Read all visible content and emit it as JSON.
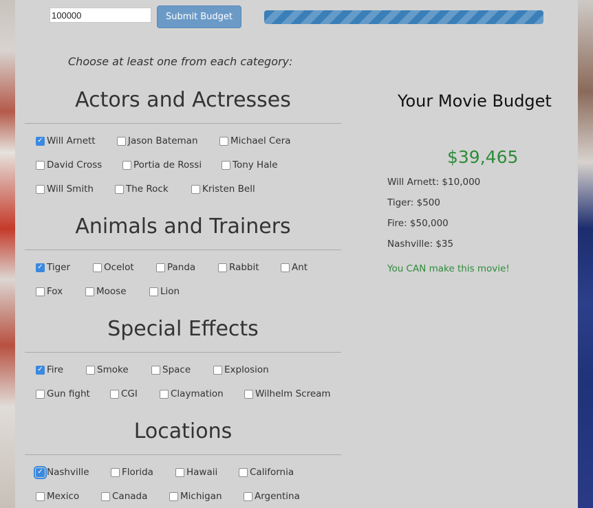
{
  "budget_form": {
    "input_value": "100000",
    "submit_label": "Submit Budget",
    "progress_fraction": 1.0,
    "progress_color": "#3a7fb8"
  },
  "instruction": "Choose at least one from each category:",
  "categories": [
    {
      "title": "Actors and Actresses",
      "options": [
        {
          "label": "Will Arnett",
          "checked": true
        },
        {
          "label": "Jason Bateman",
          "checked": false
        },
        {
          "label": "Michael Cera",
          "checked": false
        },
        {
          "label": "David Cross",
          "checked": false
        },
        {
          "label": "Portia de Rossi",
          "checked": false
        },
        {
          "label": "Tony Hale",
          "checked": false
        },
        {
          "label": "Will Smith",
          "checked": false
        },
        {
          "label": "The Rock",
          "checked": false
        },
        {
          "label": "Kristen Bell",
          "checked": false
        }
      ]
    },
    {
      "title": "Animals and Trainers",
      "options": [
        {
          "label": "Tiger",
          "checked": true
        },
        {
          "label": "Ocelot",
          "checked": false
        },
        {
          "label": "Panda",
          "checked": false
        },
        {
          "label": "Rabbit",
          "checked": false
        },
        {
          "label": "Ant",
          "checked": false
        },
        {
          "label": "Fox",
          "checked": false
        },
        {
          "label": "Moose",
          "checked": false
        },
        {
          "label": "Lion",
          "checked": false
        }
      ]
    },
    {
      "title": "Special Effects",
      "options": [
        {
          "label": "Fire",
          "checked": true
        },
        {
          "label": "Smoke",
          "checked": false
        },
        {
          "label": "Space",
          "checked": false
        },
        {
          "label": "Explosion",
          "checked": false
        },
        {
          "label": "Gun fight",
          "checked": false
        },
        {
          "label": "CGI",
          "checked": false
        },
        {
          "label": "Claymation",
          "checked": false
        },
        {
          "label": "Wilhelm Scream",
          "checked": false
        }
      ]
    },
    {
      "title": "Locations",
      "options": [
        {
          "label": "Nashville",
          "checked": true,
          "focused": true
        },
        {
          "label": "Florida",
          "checked": false
        },
        {
          "label": "Hawaii",
          "checked": false
        },
        {
          "label": "California",
          "checked": false
        },
        {
          "label": "Mexico",
          "checked": false
        },
        {
          "label": "Canada",
          "checked": false
        },
        {
          "label": "Michigan",
          "checked": false
        },
        {
          "label": "Argentina",
          "checked": false
        }
      ]
    }
  ],
  "summary": {
    "title": "Your Movie Budget",
    "total": "$39,465",
    "items": [
      "Will Arnett: $10,000",
      "Tiger: $500",
      "Fire: $50,000",
      "Nashville: $35"
    ],
    "status": "You CAN make this movie!",
    "status_color": "#2e8b3a"
  }
}
